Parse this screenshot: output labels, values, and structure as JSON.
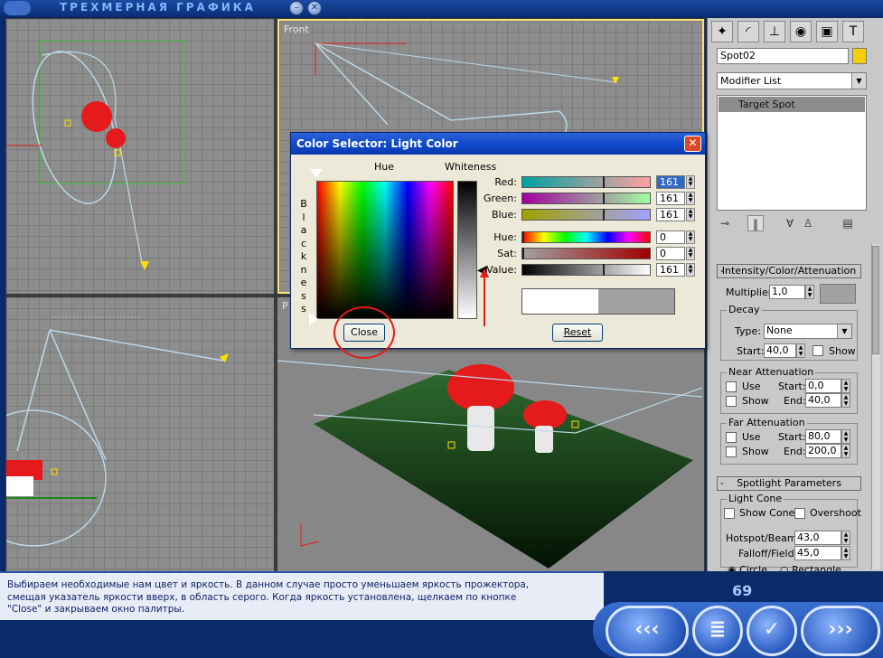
{
  "app": {
    "title": "ТРЕХМЕРНАЯ ГРАФИКА",
    "min_glyph": "–",
    "close_glyph": "✕"
  },
  "viewports": {
    "top_left_label": "",
    "front_label": "Front",
    "persp_label": "P"
  },
  "command_panel": {
    "tab_icons": [
      "cursor-icon",
      "modify-icon",
      "hierarchy-icon",
      "motion-icon",
      "display-icon",
      "utilities-icon"
    ],
    "object_name": "Spot02",
    "object_color": "#f5d000",
    "modifier_list": "Modifier List",
    "stack_item": "Target Spot",
    "rollout_intensity": {
      "title": "Intensity/Color/Attenuation",
      "multiplier_label": "Multiplier:",
      "multiplier_value": "1,0",
      "decay": {
        "title": "Decay",
        "type_label": "Type:",
        "type_value": "None",
        "start_label": "Start:",
        "start_value": "40,0",
        "show_label": "Show"
      },
      "near": {
        "title": "Near Attenuation",
        "use_label": "Use",
        "show_label": "Show",
        "start_label": "Start:",
        "start_value": "0,0",
        "end_label": "End:",
        "end_value": "40,0"
      },
      "far": {
        "title": "Far Attenuation",
        "use_label": "Use",
        "show_label": "Show",
        "start_label": "Start:",
        "start_value": "80,0",
        "end_label": "End:",
        "end_value": "200,0"
      }
    },
    "rollout_spot": {
      "title": "Spotlight Parameters",
      "cone_title": "Light Cone",
      "show_cone": "Show Cone",
      "overshoot": "Overshoot",
      "hotspot_label": "Hotspot/Beam:",
      "hotspot_value": "43,0",
      "falloff_label": "Falloff/Field:",
      "falloff_value": "45,0",
      "circle": "Circle",
      "rectangle": "Rectangle"
    }
  },
  "dialog": {
    "title": "Color Selector: Light Color",
    "hue_label": "Hue",
    "whiteness_label": "Whiteness",
    "blackness_letters": [
      "B",
      "l",
      "a",
      "c",
      "k",
      "n",
      "e",
      "s",
      "s"
    ],
    "sliders": [
      {
        "label": "Red:",
        "value": "161",
        "level": 0.63,
        "selected": true,
        "grad": "linear-gradient(to right,#00a1a1,#ffa1a1)"
      },
      {
        "label": "Green:",
        "value": "161",
        "level": 0.63,
        "selected": false,
        "grad": "linear-gradient(to right,#a100a1,#a1ffa1)"
      },
      {
        "label": "Blue:",
        "value": "161",
        "level": 0.63,
        "selected": false,
        "grad": "linear-gradient(to right,#a1a100,#a1a1ff)"
      },
      {
        "label": "Hue:",
        "value": "0",
        "level": 0.0,
        "selected": false,
        "grad": "linear-gradient(to right,#f00,#ff0,#0f0,#0ff,#00f,#f0f,#f00)"
      },
      {
        "label": "Sat:",
        "value": "0",
        "level": 0.0,
        "selected": false,
        "grad": "linear-gradient(to right,#a1a1a1,#a10000)"
      },
      {
        "label": "Value:",
        "value": "161",
        "level": 0.63,
        "selected": false,
        "grad": "linear-gradient(to right,#000,#fff)"
      }
    ],
    "close_label": "Close",
    "reset_label": "Reset"
  },
  "caption": {
    "text_lines": [
      "Выбираем необходимые нам цвет и яркость. В данном случае просто уменьшаем яркость прожектора,",
      "смещая указатель яркости вверх, в область серого. Когда яркость установлена, щелкаем по кнопке",
      "\"Close\" и закрываем окно палитры."
    ],
    "page_number": "69"
  },
  "nav": {
    "prev": "‹‹‹",
    "menu": "≣",
    "check": "✓",
    "next": "›››"
  }
}
